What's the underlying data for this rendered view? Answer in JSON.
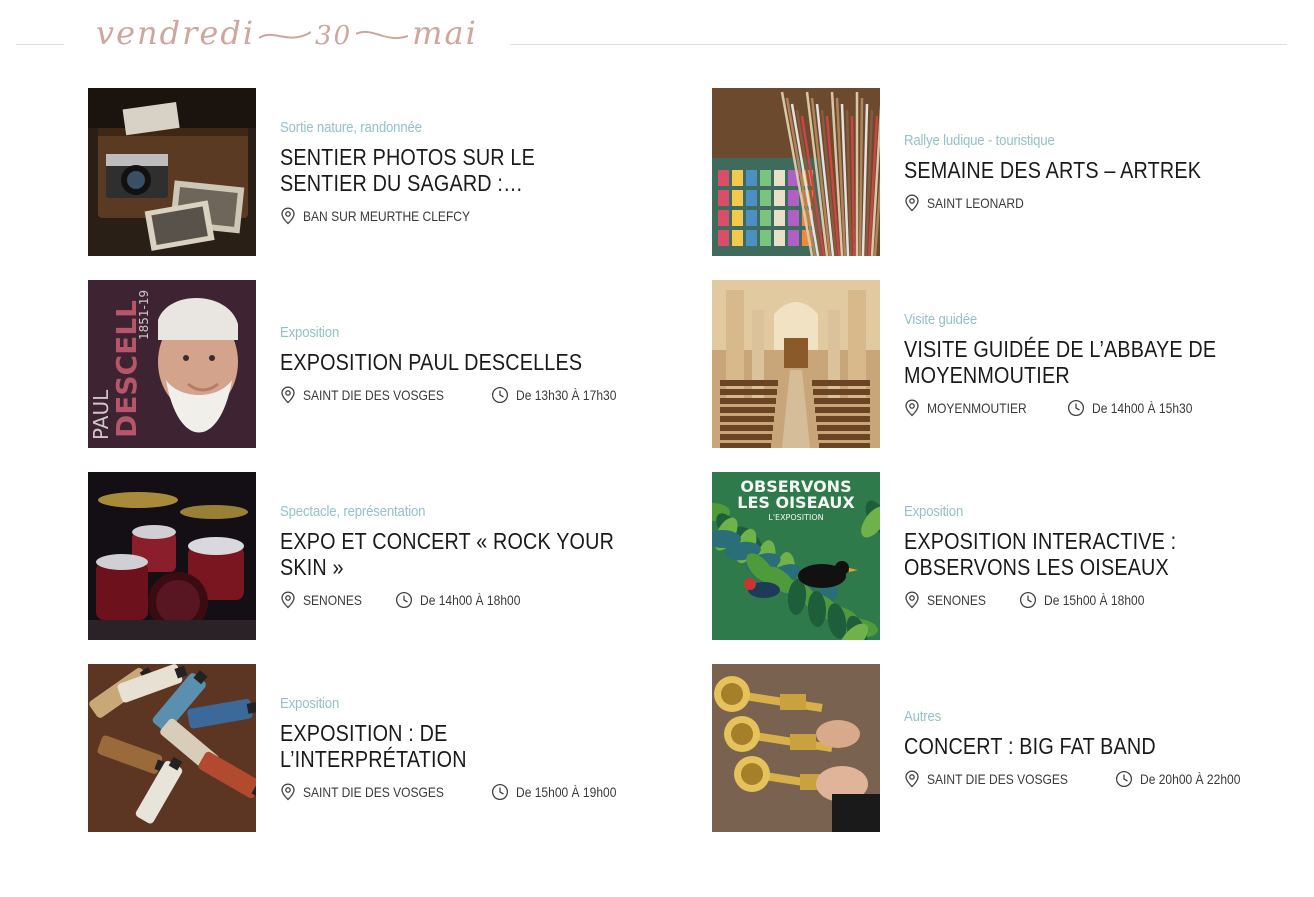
{
  "date_header": {
    "weekday": "vendredi",
    "day": "30",
    "month": "mai"
  },
  "colors": {
    "accent_date": "#cfa69d",
    "category": "#93c2c7",
    "title": "#1a1a1a"
  },
  "events": [
    {
      "category": "Sortie nature, randonnée",
      "title": "Sentier photos sur le sentier du Sagard : L’hydraulique, les eaux…",
      "location": "BAN SUR MEURTHE CLEFCY",
      "time": "",
      "thumb_icon": "vintage-camera-photos"
    },
    {
      "category": "Rallye ludique - touristique",
      "title": "Semaine des Arts – Artrek",
      "location": "SAINT LEONARD",
      "time": "",
      "thumb_icon": "paint-brushes-pastels"
    },
    {
      "category": "Exposition",
      "title": "Exposition Paul Descelles",
      "location": "SAINT DIE DES VOSGES",
      "time": "De 13h30 À 17h30",
      "thumb_icon": "portrait-paul-descelles",
      "thumb_text": "PAUL DESCELLES",
      "thumb_subtext": "1851-19"
    },
    {
      "category": "Visite guidée",
      "title": "Visite guidée de l’abbaye de Moyenmoutier",
      "location": "MOYENMOUTIER",
      "time": "De 14h00 À 15h30",
      "thumb_icon": "church-nave"
    },
    {
      "category": "Spectacle, représentation",
      "title": "Expo et concert « Rock Your Skin »",
      "location": "SENONES",
      "time": "De 14h00 À 18h00",
      "thumb_icon": "drum-kit"
    },
    {
      "category": "Exposition",
      "title": "Exposition interactive : Observons les oiseaux",
      "location": "SENONES",
      "time": "De 15h00 À 18h00",
      "thumb_icon": "birds-poster",
      "thumb_text": "OBSERVONS LES OISEAUX",
      "thumb_subtext": "L'EXPOSITION"
    },
    {
      "category": "Exposition",
      "title": "Exposition : De l’interprétation",
      "location": "SAINT DIE DES VOSGES",
      "time": "De 15h00 À 19h00",
      "thumb_icon": "paint-tubes"
    },
    {
      "category": "Autres",
      "title": "Concert : Big Fat Band",
      "location": "SAINT DIE DES VOSGES",
      "time": "De 20h00 À 22h00",
      "thumb_icon": "trumpets"
    }
  ]
}
